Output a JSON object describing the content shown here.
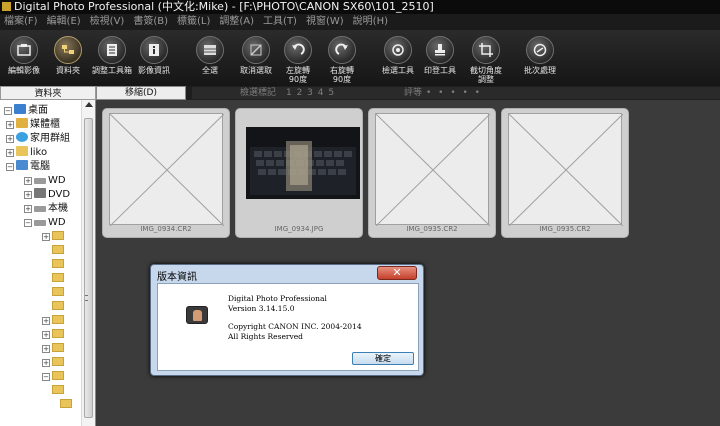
{
  "window": {
    "title": "Digital Photo Professional (中文化:Mike) - [F:\\PHOTO\\CANON SX60\\101_2510]"
  },
  "menu": [
    "檔案(F)",
    "編輯(E)",
    "檢視(V)",
    "書簽(B)",
    "標籤(L)",
    "調整(A)",
    "工具(T)",
    "視窗(W)",
    "說明(H)"
  ],
  "toolbar": {
    "buttons": [
      {
        "label": "編輯影像",
        "icon": "edit-image-icon"
      },
      {
        "label": "資料夾",
        "icon": "folder-icon"
      },
      {
        "label": "調整工具箱",
        "icon": "tool-palette-icon"
      },
      {
        "label": "影像資訊",
        "icon": "info-icon"
      },
      {
        "label": "全選",
        "icon": "select-all-icon"
      },
      {
        "label": "取消選取",
        "icon": "deselect-icon"
      },
      {
        "label": "左旋轉\n90度",
        "icon": "rotate-left-icon"
      },
      {
        "label": "右旋轉\n90度",
        "icon": "rotate-right-icon"
      },
      {
        "label": "檢選工具",
        "icon": "quick-check-icon"
      },
      {
        "label": "印登工具",
        "icon": "stamp-icon"
      },
      {
        "label": "截切角度\n調整",
        "icon": "crop-icon"
      },
      {
        "label": "批次處理",
        "icon": "batch-icon"
      }
    ]
  },
  "tabs": {
    "folder": "資料夾",
    "thumbnails": "移縮(D)"
  },
  "filter": {
    "rating_label": "檢選標記",
    "rating_marks": "1 2 3 4 5",
    "stars_label": "評等",
    "stars": "• • • • •"
  },
  "tree": {
    "items": [
      {
        "label": "桌面",
        "icon": "desktop-icon"
      },
      {
        "label": "媒體櫃",
        "icon": "library-icon"
      },
      {
        "label": "家用群組",
        "icon": "homegroup-icon"
      },
      {
        "label": "liko",
        "icon": "user-folder-icon"
      },
      {
        "label": "電腦",
        "icon": "computer-icon"
      },
      {
        "label": "WD",
        "icon": "drive-icon"
      },
      {
        "label": "DVD",
        "icon": "dvd-icon"
      },
      {
        "label": "本機",
        "icon": "drive-icon"
      },
      {
        "label": "WD",
        "icon": "drive-icon"
      }
    ]
  },
  "thumbnails": [
    {
      "name": "IMG_0934.CR2",
      "has_preview": false
    },
    {
      "name": "IMG_0934.JPG",
      "has_preview": true
    },
    {
      "name": "IMG_0935.CR2",
      "has_preview": false
    },
    {
      "name": "IMG_0935.CR2",
      "has_preview": false
    }
  ],
  "dialog": {
    "title": "版本資訊",
    "close": "✕",
    "product": "Digital Photo Professional",
    "version": "Version 3.14.15.0",
    "copyright": "Copyright CANON INC. 2004-2014",
    "rights": "All Rights Reserved",
    "ok": "確定"
  }
}
